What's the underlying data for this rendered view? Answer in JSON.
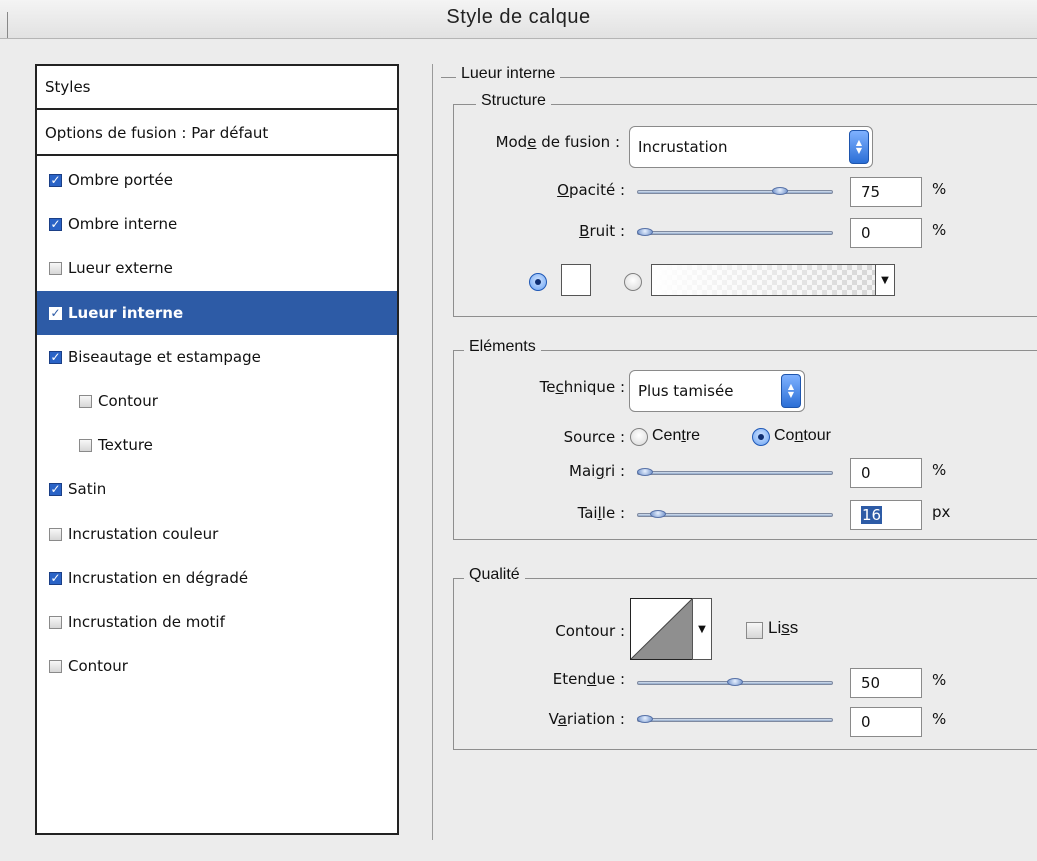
{
  "window": {
    "title": "Style de calque"
  },
  "styles_panel": {
    "header": "Styles",
    "blending_options": "Options de fusion : Par défaut",
    "items": [
      {
        "label": "Ombre portée",
        "checked": true,
        "selected": false,
        "indent": false
      },
      {
        "label": "Ombre interne",
        "checked": true,
        "selected": false,
        "indent": false
      },
      {
        "label": "Lueur externe",
        "checked": false,
        "selected": false,
        "indent": false
      },
      {
        "label": "Lueur interne",
        "checked": true,
        "selected": true,
        "indent": false
      },
      {
        "label": "Biseautage et estampage",
        "checked": true,
        "selected": false,
        "indent": false
      },
      {
        "label": "Contour",
        "checked": false,
        "selected": false,
        "indent": true
      },
      {
        "label": "Texture",
        "checked": false,
        "selected": false,
        "indent": true
      },
      {
        "label": "Satin",
        "checked": true,
        "selected": false,
        "indent": false
      },
      {
        "label": "Incrustation couleur",
        "checked": false,
        "selected": false,
        "indent": false
      },
      {
        "label": "Incrustation en dégradé",
        "checked": true,
        "selected": false,
        "indent": false
      },
      {
        "label": "Incrustation de motif",
        "checked": false,
        "selected": false,
        "indent": false
      },
      {
        "label": "Contour",
        "checked": false,
        "selected": false,
        "indent": false
      }
    ]
  },
  "inner_glow": {
    "title": "Lueur interne",
    "structure": {
      "title": "Structure",
      "blend_mode_label": "Mode de fusion :",
      "blend_mode_value": "Incrustation",
      "opacity_label": "Opacité :",
      "opacity_value": "75",
      "opacity_level": 75,
      "opacity_unit": "%",
      "noise_label": "Bruit :",
      "noise_value": "0",
      "noise_level": 0,
      "noise_unit": "%",
      "color_option_selected": "solid"
    },
    "elements": {
      "title": "Eléments",
      "technique_label": "Technique :",
      "technique_value": "Plus tamisée",
      "source_label": "Source :",
      "source_center": "Centre",
      "source_edge": "Contour",
      "source_selected": "edge",
      "choke_label": "Maigri :",
      "choke_value": "0",
      "choke_level": 0,
      "choke_unit": "%",
      "size_label": "Taille :",
      "size_value": "16",
      "size_level": 7,
      "size_unit": "px"
    },
    "quality": {
      "title": "Qualité",
      "contour_label": "Contour :",
      "antialias_label": "Liss",
      "antialias_checked": false,
      "range_label": "Etendue :",
      "range_value": "50",
      "range_level": 50,
      "range_unit": "%",
      "jitter_label": "Variation :",
      "jitter_value": "0",
      "jitter_level": 0,
      "jitter_unit": "%"
    }
  }
}
